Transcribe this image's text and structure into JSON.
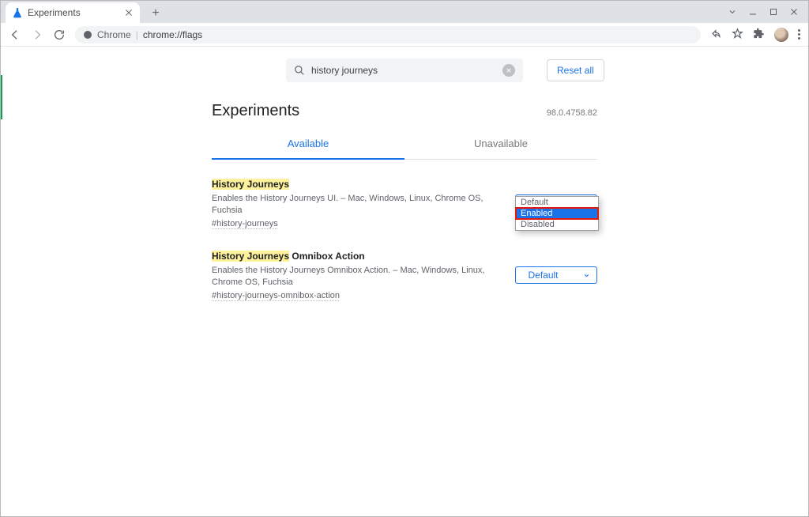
{
  "window": {
    "tab_title": "Experiments",
    "url_prefix": "Chrome",
    "url_path": "chrome://flags"
  },
  "search": {
    "value": "history journeys"
  },
  "reset_label": "Reset all",
  "page_title": "Experiments",
  "version": "98.0.4758.82",
  "tabs": {
    "available": "Available",
    "unavailable": "Unavailable"
  },
  "flags": [
    {
      "title_hl": "History Journeys",
      "title_rest": "",
      "desc": "Enables the History Journeys UI. – Mac, Windows, Linux, Chrome OS, Fuchsia",
      "hash": "#history-journeys",
      "select_value": "Default",
      "dropdown_open": true
    },
    {
      "title_hl": "History Journeys",
      "title_rest": " Omnibox Action",
      "desc": "Enables the History Journeys Omnibox Action. – Mac, Windows, Linux, Chrome OS, Fuchsia",
      "hash": "#history-journeys-omnibox-action",
      "select_value": "Default",
      "dropdown_open": false
    }
  ],
  "dropdown_options": [
    "Default",
    "Enabled",
    "Disabled"
  ]
}
